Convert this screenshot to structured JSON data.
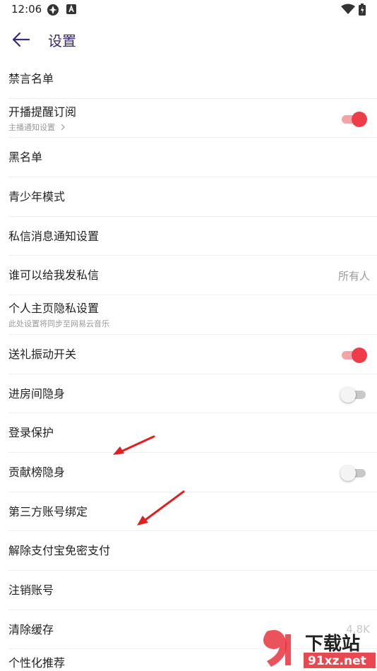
{
  "status_bar": {
    "time": "12:06"
  },
  "header": {
    "title": "设置"
  },
  "settings": {
    "items": [
      {
        "label": "禁言名单"
      },
      {
        "label": "开播提醒订阅",
        "sub": "主播通知设置",
        "toggle": "on"
      },
      {
        "label": "黑名单"
      },
      {
        "label": "青少年模式"
      },
      {
        "label": "私信消息通知设置"
      },
      {
        "label": "谁可以给我发私信",
        "value": "所有人"
      },
      {
        "label": "个人主页隐私设置",
        "sub": "此处设置将同步至网易云音乐"
      },
      {
        "label": "送礼振动开关",
        "toggle": "on"
      },
      {
        "label": "进房间隐身",
        "toggle": "off"
      },
      {
        "label": "登录保护"
      },
      {
        "label": "贡献榜隐身",
        "toggle": "off"
      },
      {
        "label": "第三方账号绑定"
      },
      {
        "label": "解除支付宝免密支付"
      },
      {
        "label": "注销账号"
      },
      {
        "label": "清除缓存",
        "value": "4.8K"
      },
      {
        "label": "个性化推荐"
      }
    ]
  },
  "watermark": {
    "brand_top": "下载站",
    "brand_bottom": "91xz.net"
  },
  "colors": {
    "accent": "#ee3d48",
    "title": "#3a2a6e",
    "annotation_arrow": "#e02020"
  }
}
